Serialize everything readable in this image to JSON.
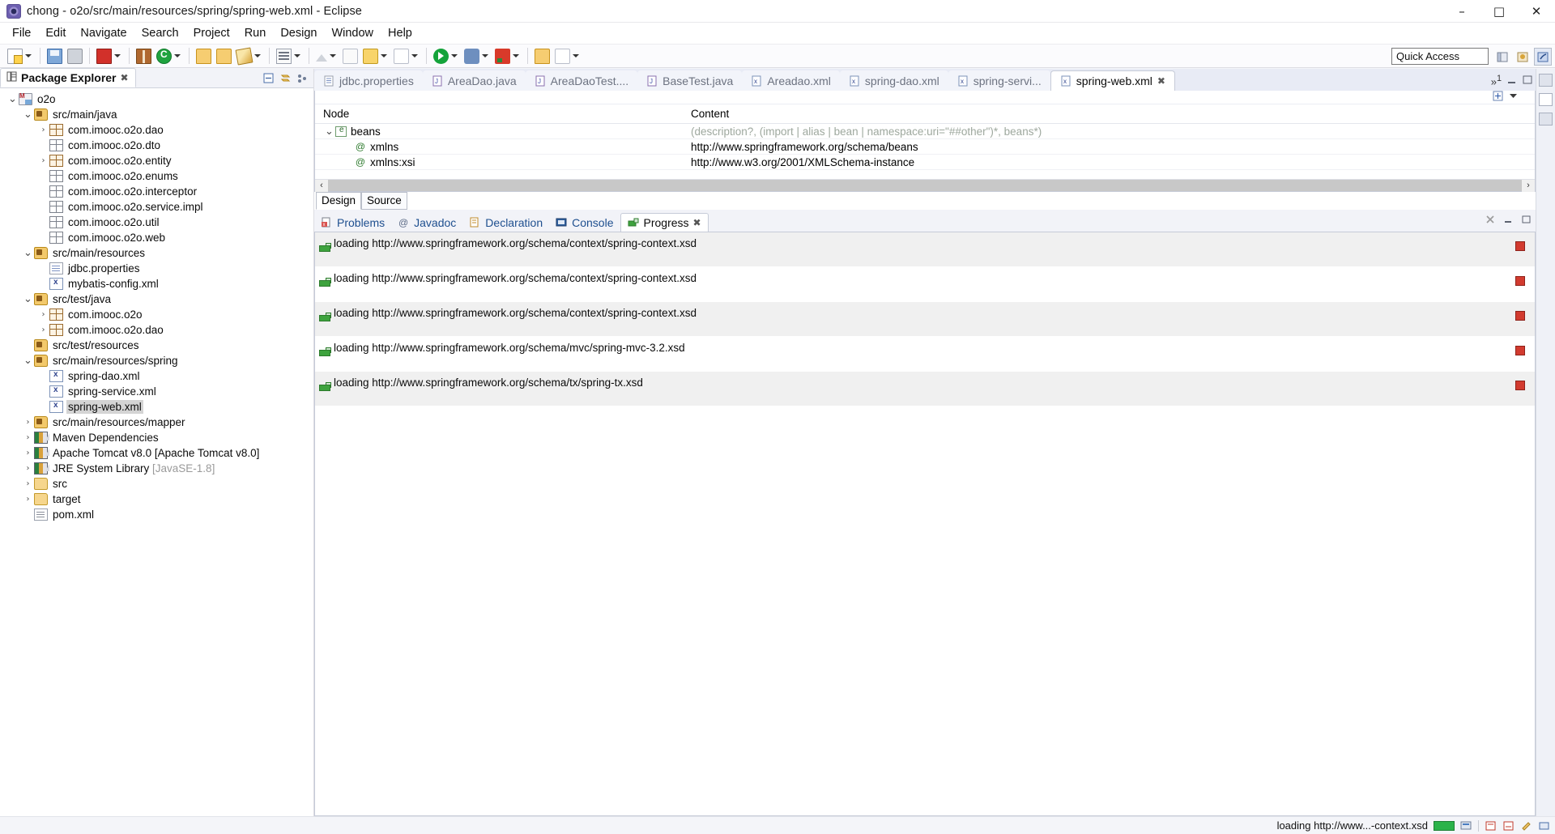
{
  "window": {
    "title": "chong - o2o/src/main/resources/spring/spring-web.xml - Eclipse",
    "app_icon": "eclipse-icon",
    "minimize": "–",
    "maximize": "□",
    "close": "✕"
  },
  "menubar": {
    "items": [
      "File",
      "Edit",
      "Navigate",
      "Search",
      "Project",
      "Run",
      "Design",
      "Window",
      "Help"
    ]
  },
  "toolbar": {
    "quick_access_placeholder": "Quick Access",
    "quick_access_value": "Quick Access",
    "icons": [
      "new-wizard-icon",
      "save-icon",
      "print-icon",
      "book-icon",
      "git-icon",
      "open-folder-icon",
      "open-folder2-icon",
      "pencil-icon",
      "outline-icon",
      "up-arrow-icon",
      "callout-icon",
      "callout-yellow-icon",
      "callout-grey-icon",
      "run-icon",
      "debug-icon",
      "tomcat-icon",
      "error-icon"
    ],
    "perspective_buttons": [
      "open-perspective-icon",
      "java-ee-perspective-icon",
      "java-perspective-icon"
    ]
  },
  "package_explorer": {
    "tab_label": "Package Explorer",
    "close_label": "✖",
    "toolbar_icons": [
      "collapse-all-icon",
      "link-with-editor-icon",
      "view-menu-icon"
    ],
    "tree": [
      {
        "label": "o2o",
        "depth": 0,
        "twist": "v",
        "icon": "maven-project-icon",
        "selected": false
      },
      {
        "label": "src/main/java",
        "depth": 1,
        "twist": "v",
        "icon": "source-folder-icon",
        "selected": false
      },
      {
        "label": "com.imooc.o2o.dao",
        "depth": 2,
        "twist": ">",
        "icon": "package-full-icon",
        "selected": false
      },
      {
        "label": "com.imooc.o2o.dto",
        "depth": 2,
        "twist": "",
        "icon": "package-icon",
        "selected": false
      },
      {
        "label": "com.imooc.o2o.entity",
        "depth": 2,
        "twist": ">",
        "icon": "package-full-icon",
        "selected": false
      },
      {
        "label": "com.imooc.o2o.enums",
        "depth": 2,
        "twist": "",
        "icon": "package-icon",
        "selected": false
      },
      {
        "label": "com.imooc.o2o.interceptor",
        "depth": 2,
        "twist": "",
        "icon": "package-icon",
        "selected": false
      },
      {
        "label": "com.imooc.o2o.service.impl",
        "depth": 2,
        "twist": "",
        "icon": "package-icon",
        "selected": false
      },
      {
        "label": "com.imooc.o2o.util",
        "depth": 2,
        "twist": "",
        "icon": "package-icon",
        "selected": false
      },
      {
        "label": "com.imooc.o2o.web",
        "depth": 2,
        "twist": "",
        "icon": "package-icon",
        "selected": false
      },
      {
        "label": "src/main/resources",
        "depth": 1,
        "twist": "v",
        "icon": "source-folder-icon",
        "selected": false
      },
      {
        "label": "jdbc.properties",
        "depth": 2,
        "twist": "",
        "icon": "properties-file-icon",
        "selected": false
      },
      {
        "label": "mybatis-config.xml",
        "depth": 2,
        "twist": "",
        "icon": "xml-file-icon",
        "selected": false
      },
      {
        "label": "src/test/java",
        "depth": 1,
        "twist": "v",
        "icon": "source-folder-icon",
        "selected": false
      },
      {
        "label": "com.imooc.o2o",
        "depth": 2,
        "twist": ">",
        "icon": "package-full-icon",
        "selected": false
      },
      {
        "label": "com.imooc.o2o.dao",
        "depth": 2,
        "twist": ">",
        "icon": "package-full-icon",
        "selected": false
      },
      {
        "label": "src/test/resources",
        "depth": 1,
        "twist": "",
        "icon": "source-folder-icon",
        "selected": false
      },
      {
        "label": "src/main/resources/spring",
        "depth": 1,
        "twist": "v",
        "icon": "source-folder-icon",
        "selected": false
      },
      {
        "label": "spring-dao.xml",
        "depth": 2,
        "twist": "",
        "icon": "xml-file-icon",
        "selected": false
      },
      {
        "label": "spring-service.xml",
        "depth": 2,
        "twist": "",
        "icon": "xml-file-icon",
        "selected": false
      },
      {
        "label": "spring-web.xml",
        "depth": 2,
        "twist": "",
        "icon": "xml-file-icon",
        "selected": true
      },
      {
        "label": "src/main/resources/mapper",
        "depth": 1,
        "twist": ">",
        "icon": "source-folder-icon",
        "selected": false
      },
      {
        "label": "Maven Dependencies",
        "depth": 1,
        "twist": ">",
        "icon": "library-icon",
        "selected": false
      },
      {
        "label": "Apache Tomcat v8.0 [Apache Tomcat v8.0]",
        "depth": 1,
        "twist": ">",
        "icon": "library-icon",
        "selected": false
      },
      {
        "label": "JRE System Library",
        "suffix": " [JavaSE-1.8]",
        "depth": 1,
        "twist": ">",
        "icon": "library-icon",
        "selected": false
      },
      {
        "label": "src",
        "depth": 1,
        "twist": ">",
        "icon": "folder-icon",
        "selected": false
      },
      {
        "label": "target",
        "depth": 1,
        "twist": ">",
        "icon": "folder-icon",
        "selected": false
      },
      {
        "label": "pom.xml",
        "depth": 1,
        "twist": "",
        "icon": "pom-file-icon",
        "selected": false
      }
    ]
  },
  "editor": {
    "tabs": [
      {
        "label": "jdbc.properties",
        "icon": "properties-file-icon",
        "active": false
      },
      {
        "label": "AreaDao.java",
        "icon": "java-file-icon",
        "active": false
      },
      {
        "label": "AreaDaoTest....",
        "icon": "java-file-icon",
        "active": false
      },
      {
        "label": "BaseTest.java",
        "icon": "java-file-icon",
        "active": false
      },
      {
        "label": "Areadao.xml",
        "icon": "xml-file-icon",
        "active": false
      },
      {
        "label": "spring-dao.xml",
        "icon": "xml-file-icon",
        "active": false
      },
      {
        "label": "spring-servi...",
        "icon": "xml-file-icon",
        "active": false
      },
      {
        "label": "spring-web.xml",
        "icon": "xml-file-icon",
        "active": true,
        "close": "✖"
      }
    ],
    "more_tabs_indicator": "»",
    "overflow_count": "1",
    "columns": {
      "node": "Node",
      "content": "Content"
    },
    "rows": [
      {
        "node": "beans",
        "node_icon": "element-icon",
        "twist": "v",
        "indent": 0,
        "content": "(description?, (import | alias | bean | namespace:uri=\"##other\")*, beans*)",
        "content_muted": true
      },
      {
        "node": "xmlns",
        "node_icon": "attribute-icon",
        "twist": "",
        "indent": 1,
        "content": "http://www.springframework.org/schema/beans",
        "content_muted": false
      },
      {
        "node": "xmlns:xsi",
        "node_icon": "attribute-icon",
        "twist": "",
        "indent": 1,
        "content": "http://www.w3.org/2001/XMLSchema-instance",
        "content_muted": false
      }
    ],
    "design_source_tabs": [
      {
        "label": "Design",
        "active": true
      },
      {
        "label": "Source",
        "active": false
      }
    ],
    "scroll_left_arrow": "‹",
    "scroll_right_arrow": "›"
  },
  "bottom_view": {
    "tabs": [
      {
        "label": "Problems",
        "icon": "problems-icon",
        "active": false
      },
      {
        "label": "Javadoc",
        "icon": "javadoc-icon",
        "active": false
      },
      {
        "label": "Declaration",
        "icon": "declaration-icon",
        "active": false
      },
      {
        "label": "Console",
        "icon": "console-icon",
        "active": false
      },
      {
        "label": "Progress",
        "icon": "progress-icon",
        "active": true,
        "close": "✖"
      }
    ],
    "toolbar_icons": [
      "remove-all-icon",
      "minimize-icon",
      "maximize-icon"
    ],
    "progress_items": [
      {
        "label": "loading http://www.springframework.org/schema/context/spring-context.xsd",
        "stop": "stop-button"
      },
      {
        "label": "loading http://www.springframework.org/schema/context/spring-context.xsd",
        "stop": "stop-button"
      },
      {
        "label": "loading http://www.springframework.org/schema/context/spring-context.xsd",
        "stop": "stop-button"
      },
      {
        "label": "loading http://www.springframework.org/schema/mvc/spring-mvc-3.2.xsd",
        "stop": "stop-button"
      },
      {
        "label": "loading http://www.springframework.org/schema/tx/spring-tx.xsd",
        "stop": "stop-button"
      }
    ]
  },
  "statusbar": {
    "message": "loading http://www...-context.xsd",
    "progress_color": "#2bb34a",
    "icons": [
      "progress-indicator",
      "background-operations-icon",
      "writable-icon",
      "insert-mode-icon",
      "edit-icon",
      "smart-insert-icon"
    ]
  },
  "colors": {
    "accent": "#1e4f8f",
    "selection": "#d4d4d4",
    "muted_text": "#9ea89e",
    "link_text": "#b08020",
    "error_red": "#d23b2f",
    "success_green": "#2bb34a"
  }
}
